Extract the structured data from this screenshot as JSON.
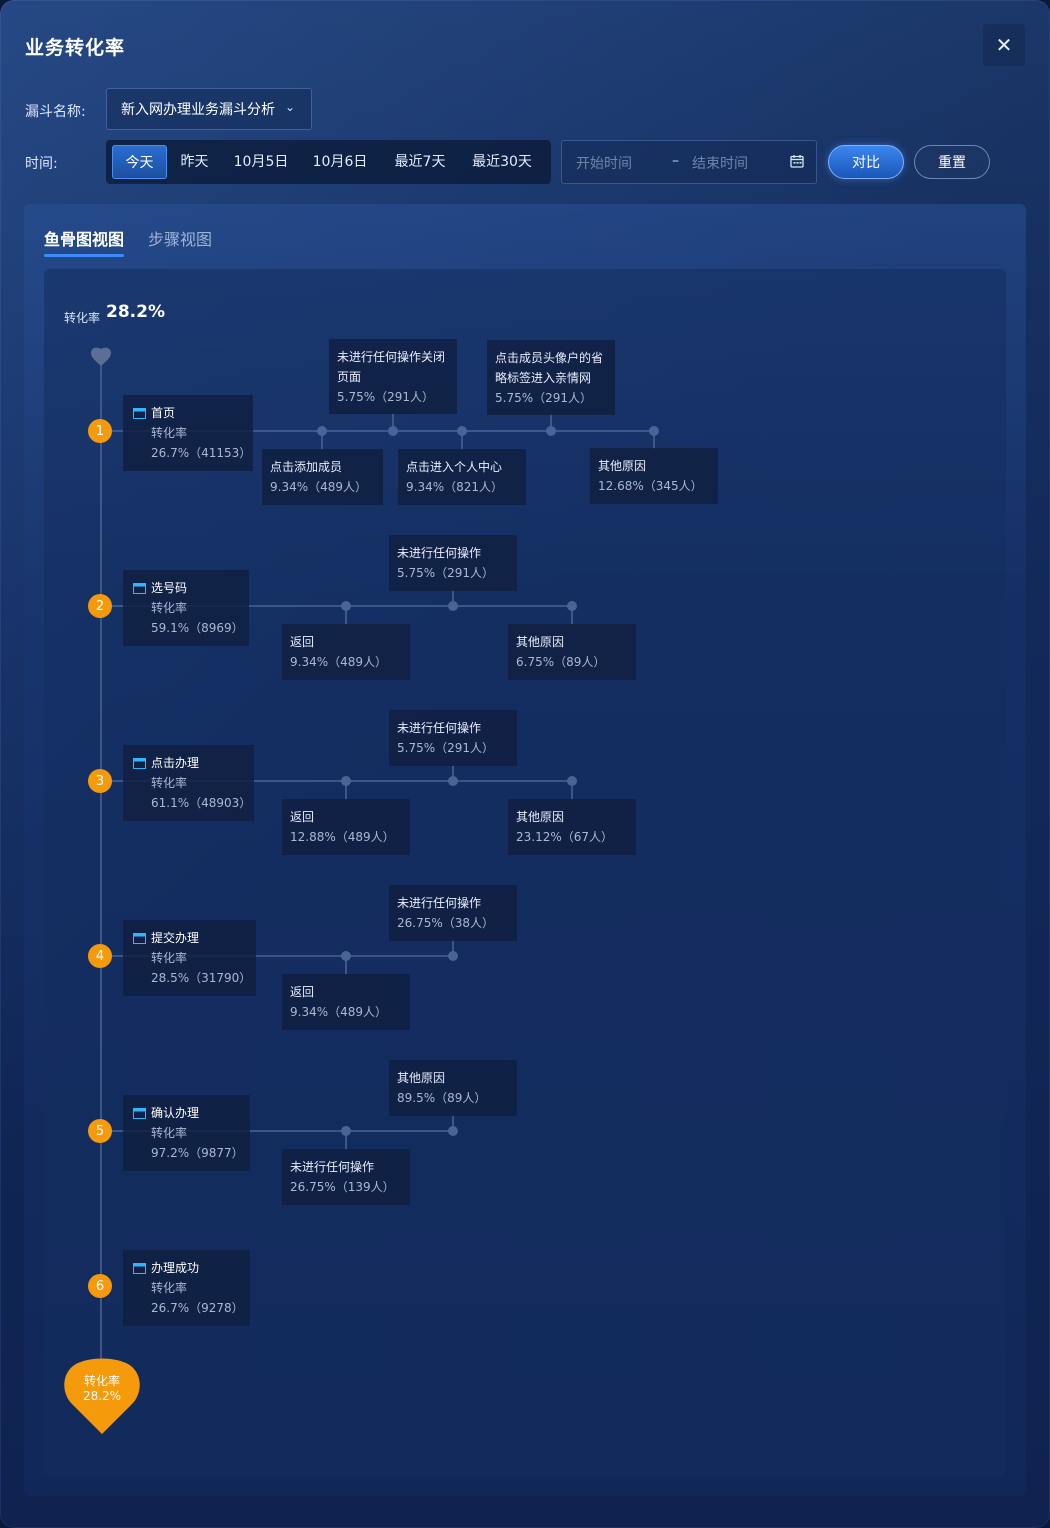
{
  "title": "业务转化率",
  "filters": {
    "funnel_label": "漏斗名称:",
    "funnel_value": "新入网办理业务漏斗分析",
    "time_label": "时间:",
    "time_tabs": [
      "今天",
      "昨天",
      "10月5日",
      "10月6日",
      "最近7天",
      "最近30天"
    ],
    "active_tab": "今天",
    "start_placeholder": "开始时间",
    "range_separator": "–",
    "end_placeholder": "结束时间",
    "compare_label": "对比",
    "reset_label": "重置"
  },
  "views": {
    "tabs": [
      "鱼骨图视图",
      "步骤视图"
    ],
    "active": "鱼骨图视图"
  },
  "summary": {
    "rate_label": "转化率",
    "rate_value": "28.2%"
  },
  "steps": [
    {
      "n": "1",
      "name": "首页",
      "rate_label": "转化率",
      "rate": "26.7%（41153）"
    },
    {
      "n": "2",
      "name": "选号码",
      "rate_label": "转化率",
      "rate": "59.1%（8969）"
    },
    {
      "n": "3",
      "name": "点击办理",
      "rate_label": "转化率",
      "rate": "61.1%（48903）"
    },
    {
      "n": "4",
      "name": "提交办理",
      "rate_label": "转化率",
      "rate": "28.5%（31790）"
    },
    {
      "n": "5",
      "name": "确认办理",
      "rate_label": "转化率",
      "rate": "97.2%（9877）"
    },
    {
      "n": "6",
      "name": "办理成功",
      "rate_label": "转化率",
      "rate": "26.7%（9278）"
    }
  ],
  "branches": [
    {
      "name": "未进行任何操作关闭页面",
      "value": "5.75%（291人）"
    },
    {
      "name": "点击成员头像户的省略标签进入亲情网",
      "value": "5.75%（291人）"
    },
    {
      "name": "点击添加成员",
      "value": "9.34%（489人）"
    },
    {
      "name": "点击进入个人中心",
      "value": "9.34%（821人）"
    },
    {
      "name": "其他原因",
      "value": "12.68%（345人）"
    },
    {
      "name": "未进行任何操作",
      "value": "5.75%（291人）"
    },
    {
      "name": "返回",
      "value": "9.34%（489人）"
    },
    {
      "name": "其他原因",
      "value": "6.75%（89人）"
    },
    {
      "name": "未进行任何操作",
      "value": "5.75%（291人）"
    },
    {
      "name": "返回",
      "value": "12.88%（489人）"
    },
    {
      "name": "其他原因",
      "value": "23.12%（67人）"
    },
    {
      "name": "未进行任何操作",
      "value": "26.75%（38人）"
    },
    {
      "name": "返回",
      "value": "9.34%（489人）"
    },
    {
      "name": "其他原因",
      "value": "89.5%（89人）"
    },
    {
      "name": "未进行任何操作",
      "value": "26.75%（139人）"
    }
  ],
  "end_pin": {
    "label": "转化率",
    "value": "28.2%"
  },
  "colors": {
    "accent": "#3b8cff",
    "badge": "#f59a0b",
    "background": "#12295a"
  }
}
